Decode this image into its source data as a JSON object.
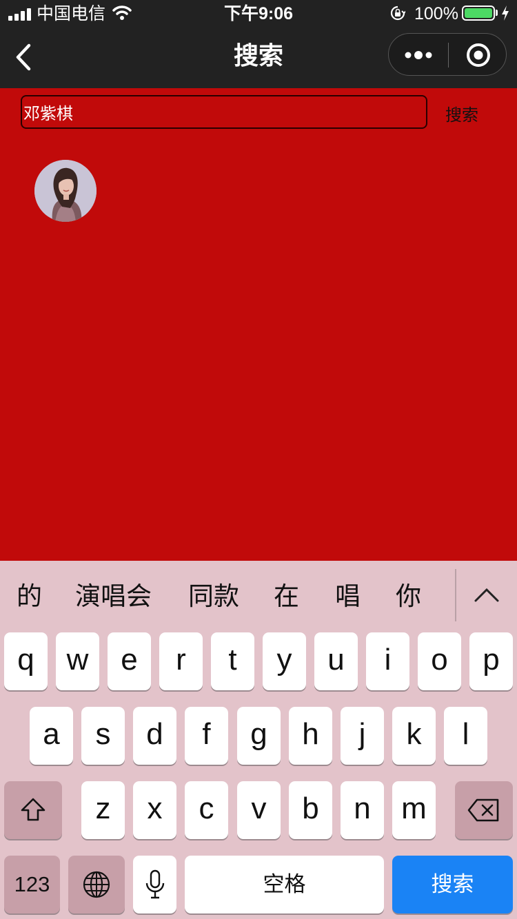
{
  "status_bar": {
    "carrier": "中国电信",
    "time": "下午9:06",
    "battery": "100%",
    "battery_level": 1.0
  },
  "nav": {
    "title": "搜索",
    "back_icon": "chevron-left-icon",
    "more_icon": "more-dots-icon",
    "close_icon": "target-circle-icon"
  },
  "search": {
    "value": "邓紫棋",
    "button_label": "搜索"
  },
  "results": [
    {
      "avatar_icon": "artist-avatar-image"
    }
  ],
  "keyboard": {
    "suggestions": [
      "的",
      "演唱会",
      "同款",
      "在",
      "唱",
      "你"
    ],
    "row1": [
      "q",
      "w",
      "e",
      "r",
      "t",
      "y",
      "u",
      "i",
      "o",
      "p"
    ],
    "row2": [
      "a",
      "s",
      "d",
      "f",
      "g",
      "h",
      "j",
      "k",
      "l"
    ],
    "row3": [
      "z",
      "x",
      "c",
      "v",
      "b",
      "n",
      "m"
    ],
    "num_label": "123",
    "space_label": "空格",
    "return_label": "搜索"
  },
  "colors": {
    "page_background": "#c10a0a",
    "nav_background": "#222222",
    "keyboard_background": "#e3c3ca",
    "return_key": "#1a83f5",
    "battery_fill": "#4cd964"
  }
}
